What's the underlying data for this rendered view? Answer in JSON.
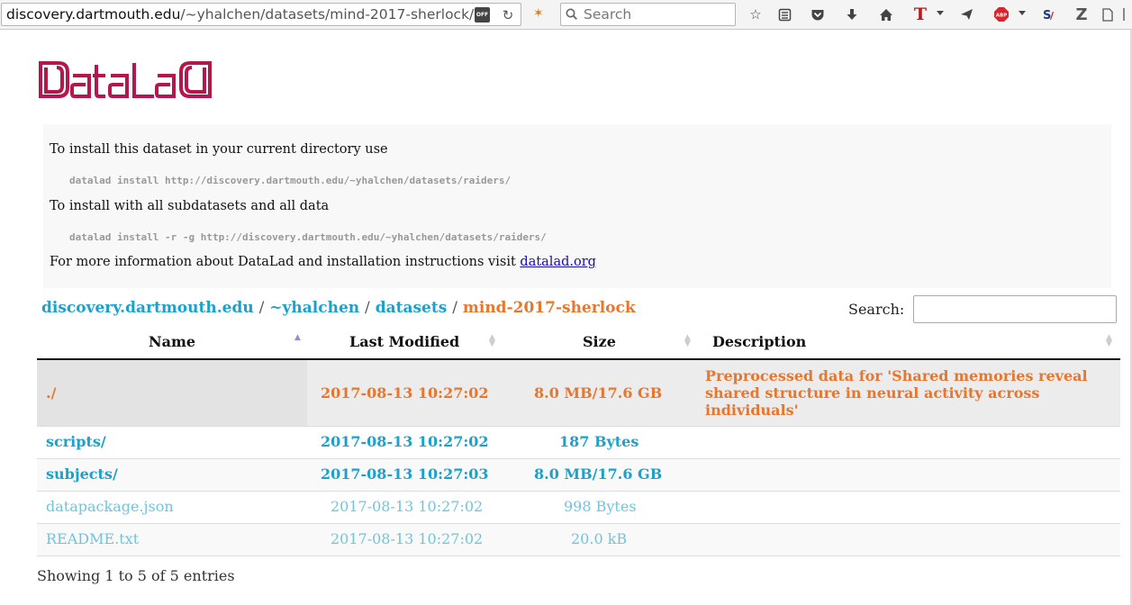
{
  "browser": {
    "url_host": "discovery.dartmouth.edu",
    "url_path": "/~yhalchen/datasets/mind-2017-sherlock/",
    "tracking_badge": "OFF",
    "search_placeholder": "Search"
  },
  "toolbar_icons": [
    "bookmark-star-icon",
    "reader-list-icon",
    "pocket-icon",
    "download-icon",
    "home-icon",
    "text-extension-icon",
    "send-icon",
    "adblock-icon",
    "sa-extension-icon",
    "zotero-icon",
    "page-icon"
  ],
  "logo": {
    "text": "DataLaD",
    "color": "#b5174d"
  },
  "install": {
    "line1": "To install this dataset in your current directory use",
    "cmd1": "datalad install http://discovery.dartmouth.edu/~yhalchen/datasets/raiders/",
    "line2": "To install with all subdatasets and all data",
    "cmd2": "datalad install -r -g http://discovery.dartmouth.edu/~yhalchen/datasets/raiders/",
    "line3_prefix": "For more information about DataLad and installation instructions visit",
    "line3_link": "datalad.org"
  },
  "breadcrumb": {
    "parts": [
      "discovery.dartmouth.edu",
      "~yhalchen",
      "datasets"
    ],
    "separator": "/",
    "current": "mind-2017-sherlock"
  },
  "search": {
    "label": "Search:",
    "value": ""
  },
  "table": {
    "headers": [
      "Name",
      "Last Modified",
      "Size",
      "Description"
    ],
    "sorted_column": "Name",
    "rows": [
      {
        "name": "./",
        "modified": "2017-08-13 10:27:02",
        "size": "8.0 MB/17.6 GB",
        "description": "Preprocessed data for 'Shared memories reveal shared structure in neural activity across individuals'",
        "kind": "current"
      },
      {
        "name": "scripts/",
        "modified": "2017-08-13 10:27:02",
        "size": "187 Bytes",
        "description": "",
        "kind": "dir"
      },
      {
        "name": "subjects/",
        "modified": "2017-08-13 10:27:03",
        "size": "8.0 MB/17.6 GB",
        "description": "",
        "kind": "dir"
      },
      {
        "name": "datapackage.json",
        "modified": "2017-08-13 10:27:02",
        "size": "998 Bytes",
        "description": "",
        "kind": "file"
      },
      {
        "name": "README.txt",
        "modified": "2017-08-13 10:27:02",
        "size": "20.0 kB",
        "description": "",
        "kind": "file"
      }
    ]
  },
  "footer": {
    "info": "Showing 1 to 5 of 5 entries"
  },
  "colors": {
    "orange": "#e8762d",
    "teal": "#1ba1cc",
    "light_teal": "#6fc5dc",
    "logo": "#b5174d"
  }
}
